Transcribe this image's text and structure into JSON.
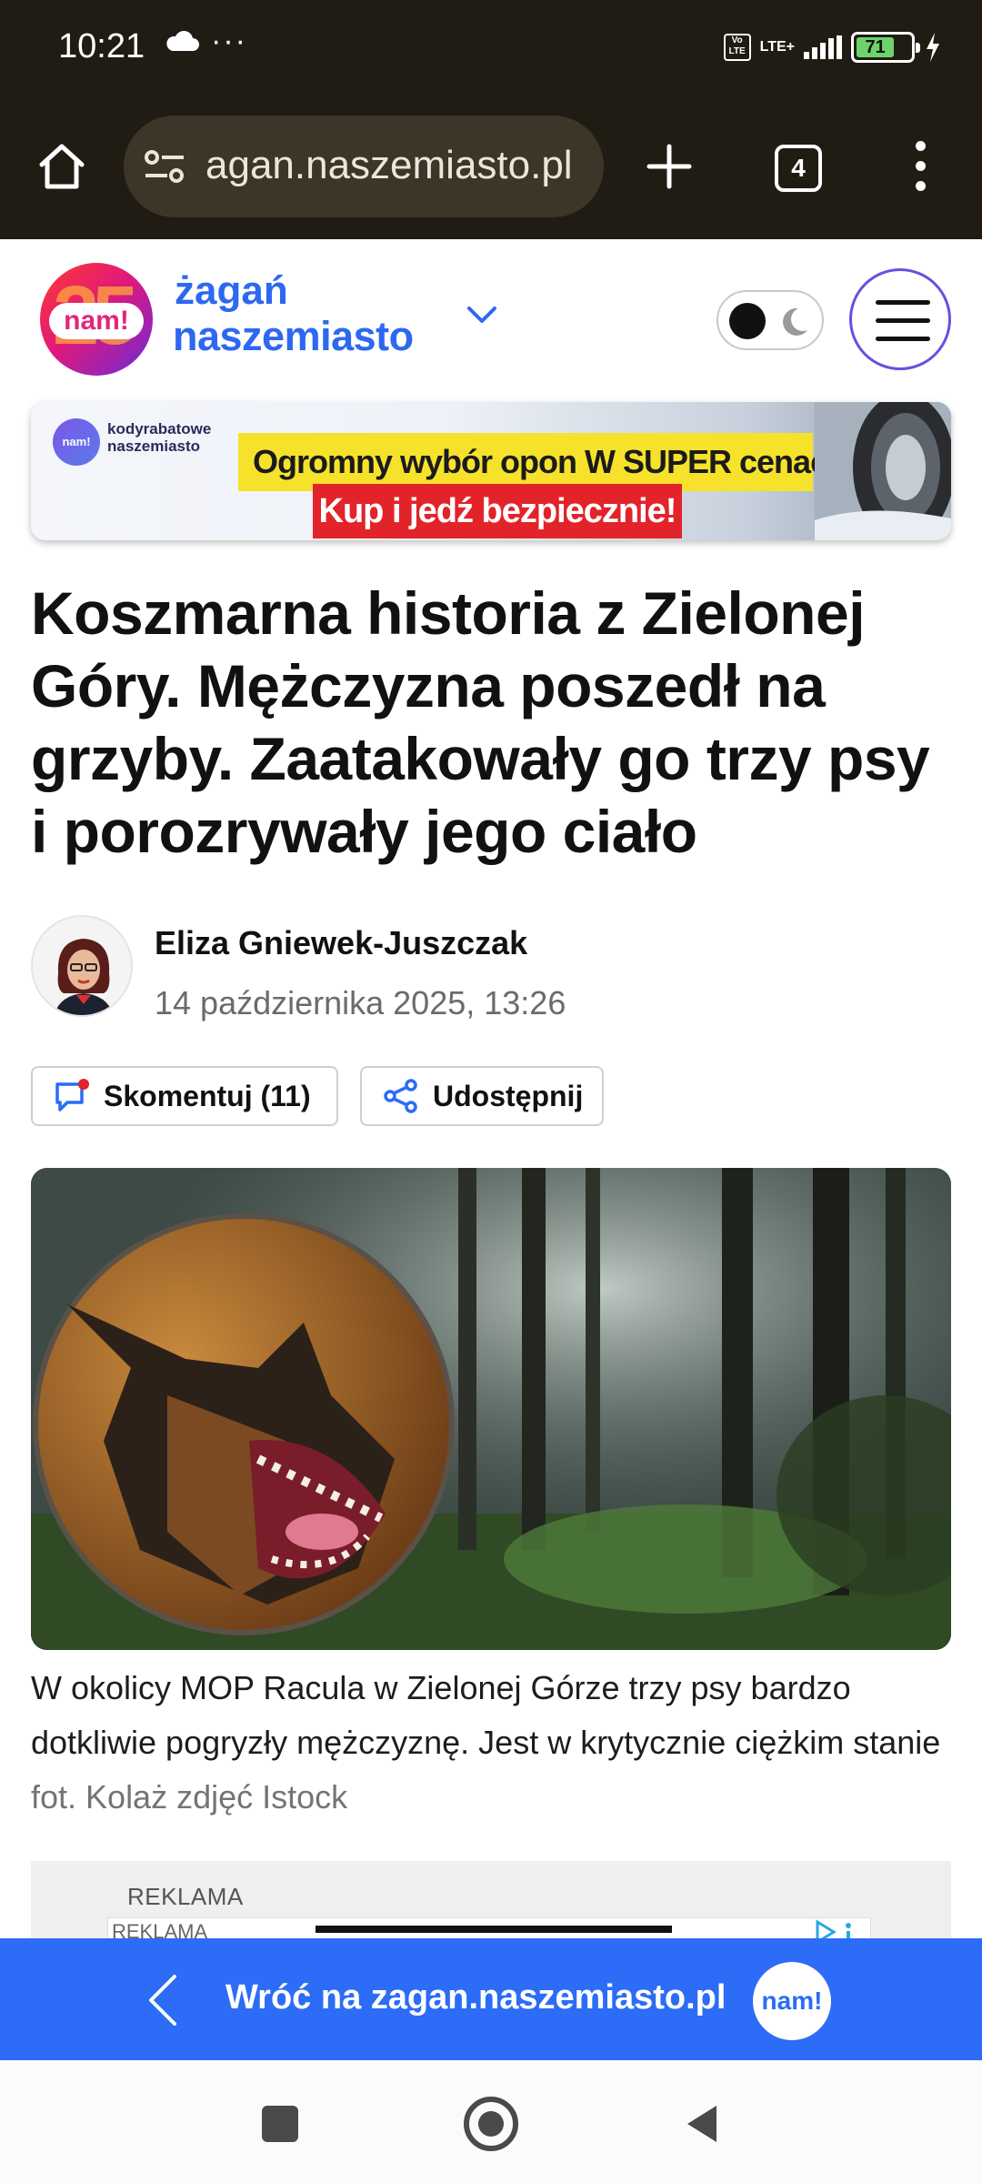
{
  "status_bar": {
    "time": "10:21",
    "more": "···",
    "network": "LTE+",
    "volte": "Vo LTE",
    "battery": "71"
  },
  "browser": {
    "url": "agan.naszemiasto.pl",
    "tab_count": "4"
  },
  "site_header": {
    "logo_text": "nam!",
    "logo_number": "25",
    "brand_city": "żagań",
    "brand_name": "naszemiasto"
  },
  "ad_banner": {
    "brand": "kodyrabatowe naszemiasto",
    "logo_text": "nam!",
    "line1": "Ogromny wybór opon W SUPER cenach!",
    "line2": "Kup i jedź bezpiecznie!"
  },
  "article": {
    "headline": "Koszmarna historia z Zielonej Góry. Mężczyzna poszedł na grzyby. Zaatakowały go trzy psy i porozrywały jego ciało",
    "author": "Eliza Gniewek-Juszczak",
    "date": "14 października 2025, 13:26",
    "comment_button": "Skomentuj (11)",
    "share_button": "Udostępnij",
    "caption": "W okolicy MOP Racula w Zielonej Górze trzy psy bardzo dotkliwie pogryzły mężczyznę. Jest w krytycznie ciężkim stanie",
    "caption_credit": "fot. Kolaż zdjęć Istock"
  },
  "ad_slot": {
    "label": "REKLAMA",
    "inner_label": "REKLAMA"
  },
  "back_bar": {
    "text": "Wróć na zagan.naszemiasto.pl",
    "logo_text": "nam!"
  },
  "colors": {
    "brand_blue": "#2c6cf6",
    "chrome_dark": "#201c14",
    "url_bar": "#3b3628"
  },
  "icons": [
    "cloud-icon",
    "home-icon",
    "tune-icon",
    "plus-icon",
    "tabs-icon",
    "menu-dots-icon",
    "chevron-down-icon",
    "moon-icon",
    "hamburger-icon",
    "comment-icon",
    "share-icon",
    "back-chevron-icon",
    "nav-recents-icon",
    "nav-home-icon",
    "nav-back-icon"
  ]
}
